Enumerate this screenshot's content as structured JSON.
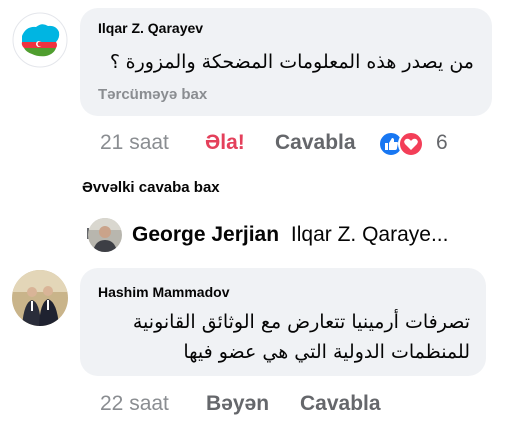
{
  "comment1": {
    "author": "Ilqar Z. Qarayev",
    "text_line1": "من يصدر هذه المعلومات المضحكة والمزورة",
    "text_line2": "؟",
    "translate_label": "Tərcüməyə bax",
    "time": "21 saat",
    "reaction_label": "Əla!",
    "reply_label": "Cavabla",
    "reaction_count": "6",
    "reaction_icons": [
      "like-icon",
      "love-icon"
    ],
    "colors": {
      "like": "#1877f2",
      "love": "#f33e58",
      "reacted": "#e4405b"
    }
  },
  "previous_replies_label": "Əvvəlki cavaba bax",
  "reply_preview": {
    "name": "George Jerjian",
    "snippet": "Ilqar Z. Qaraye..."
  },
  "comment2": {
    "author": "Hashim Mammadov",
    "text_line1": "تصرفات أرمينيا تتعارض مع الوثائق القانونية",
    "text_line2": "للمنظمات الدولية التي هي عضو فيها",
    "time": "22 saat",
    "like_label": "Bəyən",
    "reply_label": "Cavabla"
  }
}
